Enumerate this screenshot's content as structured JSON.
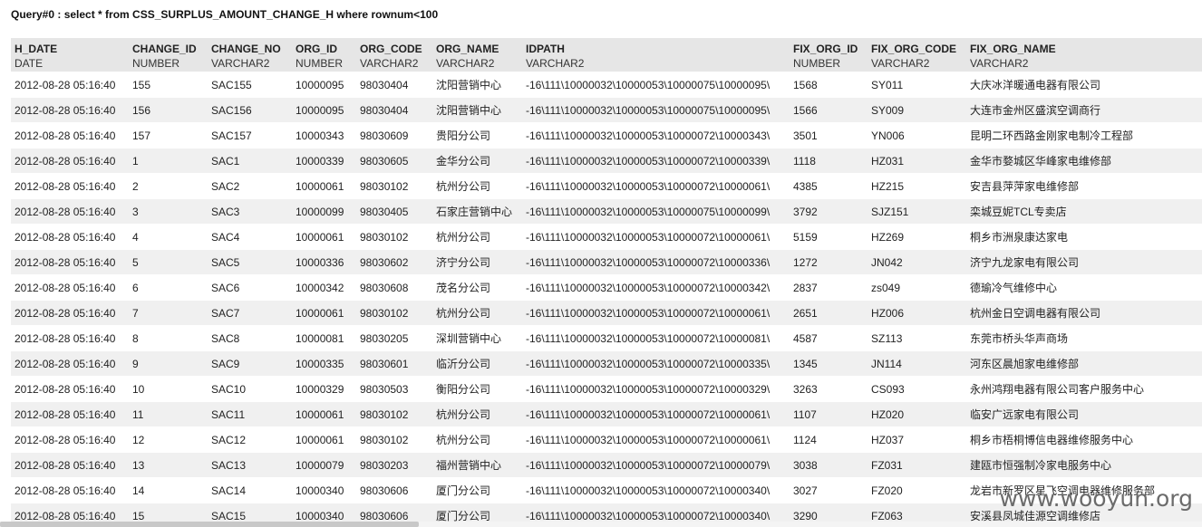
{
  "query_title": "Query#0 : select * from CSS_SURPLUS_AMOUNT_CHANGE_H where rownum<100",
  "columns": [
    {
      "name": "H_DATE",
      "type": "DATE"
    },
    {
      "name": "CHANGE_ID",
      "type": "NUMBER"
    },
    {
      "name": "CHANGE_NO",
      "type": "VARCHAR2"
    },
    {
      "name": "ORG_ID",
      "type": "NUMBER"
    },
    {
      "name": "ORG_CODE",
      "type": "VARCHAR2"
    },
    {
      "name": "ORG_NAME",
      "type": "VARCHAR2"
    },
    {
      "name": "IDPATH",
      "type": "VARCHAR2"
    },
    {
      "name": "FIX_ORG_ID",
      "type": "NUMBER"
    },
    {
      "name": "FIX_ORG_CODE",
      "type": "VARCHAR2"
    },
    {
      "name": "FIX_ORG_NAME",
      "type": "VARCHAR2"
    }
  ],
  "rows": [
    [
      "2012-08-28 05:16:40",
      "155",
      "SAC155",
      "10000095",
      "98030404",
      "沈阳营销中心",
      "-16\\111\\10000032\\10000053\\10000075\\10000095\\",
      "1568",
      "SY011",
      "大庆冰洋暖通电器有限公司"
    ],
    [
      "2012-08-28 05:16:40",
      "156",
      "SAC156",
      "10000095",
      "98030404",
      "沈阳营销中心",
      "-16\\111\\10000032\\10000053\\10000075\\10000095\\",
      "1566",
      "SY009",
      "大连市金州区盛滨空调商行"
    ],
    [
      "2012-08-28 05:16:40",
      "157",
      "SAC157",
      "10000343",
      "98030609",
      "贵阳分公司",
      "-16\\111\\10000032\\10000053\\10000072\\10000343\\",
      "3501",
      "YN006",
      "昆明二环西路金刚家电制冷工程部"
    ],
    [
      "2012-08-28 05:16:40",
      "1",
      "SAC1",
      "10000339",
      "98030605",
      "金华分公司",
      "-16\\111\\10000032\\10000053\\10000072\\10000339\\",
      "1118",
      "HZ031",
      "金华市婺城区华峰家电维修部"
    ],
    [
      "2012-08-28 05:16:40",
      "2",
      "SAC2",
      "10000061",
      "98030102",
      "杭州分公司",
      "-16\\111\\10000032\\10000053\\10000072\\10000061\\",
      "4385",
      "HZ215",
      "安吉县萍萍家电维修部"
    ],
    [
      "2012-08-28 05:16:40",
      "3",
      "SAC3",
      "10000099",
      "98030405",
      "石家庄营销中心",
      "-16\\111\\10000032\\10000053\\10000075\\10000099\\",
      "3792",
      "SJZ151",
      "栾城豆妮TCL专卖店"
    ],
    [
      "2012-08-28 05:16:40",
      "4",
      "SAC4",
      "10000061",
      "98030102",
      "杭州分公司",
      "-16\\111\\10000032\\10000053\\10000072\\10000061\\",
      "5159",
      "HZ269",
      "桐乡市洲泉康达家电"
    ],
    [
      "2012-08-28 05:16:40",
      "5",
      "SAC5",
      "10000336",
      "98030602",
      "济宁分公司",
      "-16\\111\\10000032\\10000053\\10000072\\10000336\\",
      "1272",
      "JN042",
      "济宁九龙家电有限公司"
    ],
    [
      "2012-08-28 05:16:40",
      "6",
      "SAC6",
      "10000342",
      "98030608",
      "茂名分公司",
      "-16\\111\\10000032\\10000053\\10000072\\10000342\\",
      "2837",
      "zs049",
      "德瑜冷气维修中心"
    ],
    [
      "2012-08-28 05:16:40",
      "7",
      "SAC7",
      "10000061",
      "98030102",
      "杭州分公司",
      "-16\\111\\10000032\\10000053\\10000072\\10000061\\",
      "2651",
      "HZ006",
      "杭州金日空调电器有限公司"
    ],
    [
      "2012-08-28 05:16:40",
      "8",
      "SAC8",
      "10000081",
      "98030205",
      "深圳营销中心",
      "-16\\111\\10000032\\10000053\\10000072\\10000081\\",
      "4587",
      "SZ113",
      "东莞市桥头华声商场"
    ],
    [
      "2012-08-28 05:16:40",
      "9",
      "SAC9",
      "10000335",
      "98030601",
      "临沂分公司",
      "-16\\111\\10000032\\10000053\\10000072\\10000335\\",
      "1345",
      "JN114",
      "河东区晨旭家电维修部"
    ],
    [
      "2012-08-28 05:16:40",
      "10",
      "SAC10",
      "10000329",
      "98030503",
      "衡阳分公司",
      "-16\\111\\10000032\\10000053\\10000072\\10000329\\",
      "3263",
      "CS093",
      "永州鸿翔电器有限公司客户服务中心"
    ],
    [
      "2012-08-28 05:16:40",
      "11",
      "SAC11",
      "10000061",
      "98030102",
      "杭州分公司",
      "-16\\111\\10000032\\10000053\\10000072\\10000061\\",
      "1107",
      "HZ020",
      "临安广远家电有限公司"
    ],
    [
      "2012-08-28 05:16:40",
      "12",
      "SAC12",
      "10000061",
      "98030102",
      "杭州分公司",
      "-16\\111\\10000032\\10000053\\10000072\\10000061\\",
      "1124",
      "HZ037",
      "桐乡市梧桐博信电器维修服务中心"
    ],
    [
      "2012-08-28 05:16:40",
      "13",
      "SAC13",
      "10000079",
      "98030203",
      "福州营销中心",
      "-16\\111\\10000032\\10000053\\10000072\\10000079\\",
      "3038",
      "FZ031",
      "建瓯市恒强制冷家电服务中心"
    ],
    [
      "2012-08-28 05:16:40",
      "14",
      "SAC14",
      "10000340",
      "98030606",
      "厦门分公司",
      "-16\\111\\10000032\\10000053\\10000072\\10000340\\",
      "3027",
      "FZ020",
      "龙岩市新罗区星飞空调电器维修服务部"
    ],
    [
      "2012-08-28 05:16:40",
      "15",
      "SAC15",
      "10000340",
      "98030606",
      "厦门分公司",
      "-16\\111\\10000032\\10000053\\10000072\\10000340\\",
      "3290",
      "FZ063",
      "安溪县凤城佳源空调维修店"
    ]
  ],
  "watermark": "www.wooyun.org"
}
